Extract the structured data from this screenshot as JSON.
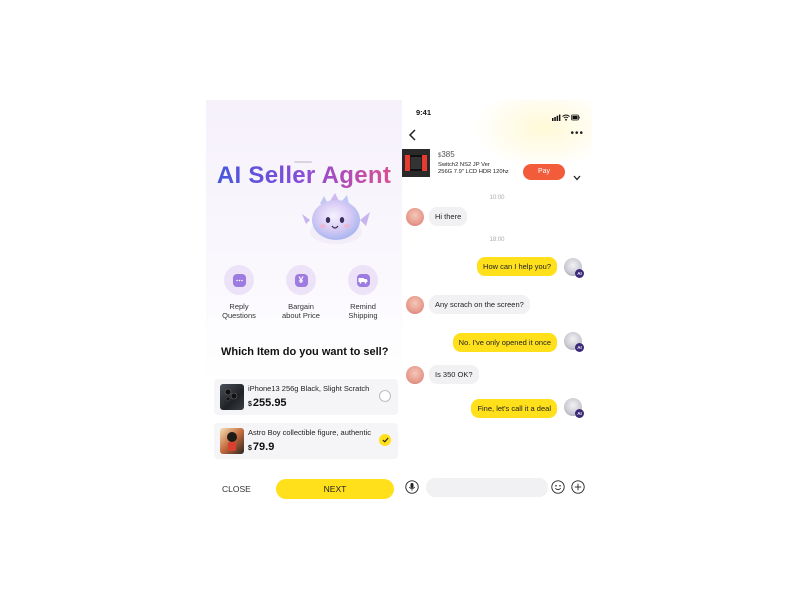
{
  "left_panel": {
    "title": "AI Seller Agent",
    "features": [
      {
        "label": "Reply\nQuestions",
        "icon": "chat-icon"
      },
      {
        "label": "Bargain\nabout Price",
        "icon": "yen-icon"
      },
      {
        "label": "Remind\nShipping",
        "icon": "truck-icon"
      }
    ],
    "question": "Which Item do you want to sell?",
    "items": [
      {
        "name": "iPhone13 256g Black, Slight Scratch",
        "currency": "$",
        "price": "255.95",
        "selected": false
      },
      {
        "name": "Astro Boy collectible figure, authentic",
        "currency": "$",
        "price": "79.9",
        "selected": true
      }
    ],
    "close_label": "CLOSE",
    "next_label": "NEXT"
  },
  "right_panel": {
    "status_time": "9:41",
    "product": {
      "currency": "$",
      "price": "385",
      "title": "Switch2 NS2 JP Ver\n256G 7.9\" LCD HDR 120hz"
    },
    "pay_label": "Pay",
    "messages": [
      {
        "type": "time",
        "text": "10:00"
      },
      {
        "type": "in",
        "text": "Hi there"
      },
      {
        "type": "time",
        "text": "18:00"
      },
      {
        "type": "out",
        "text": "How can I help you?"
      },
      {
        "type": "in",
        "text": "Any scrach on the screen?"
      },
      {
        "type": "out",
        "text": "No. I've only opened it once"
      },
      {
        "type": "in",
        "text": "Is 350 OK?"
      },
      {
        "type": "out",
        "text": "Fine, let's call it a deal"
      }
    ],
    "ai_badge": "AI",
    "composer_placeholder": ""
  },
  "colors": {
    "accent_yellow": "#ffe01a",
    "pay_orange": "#f25c3a",
    "bubble_gray": "#f1f1f3"
  }
}
